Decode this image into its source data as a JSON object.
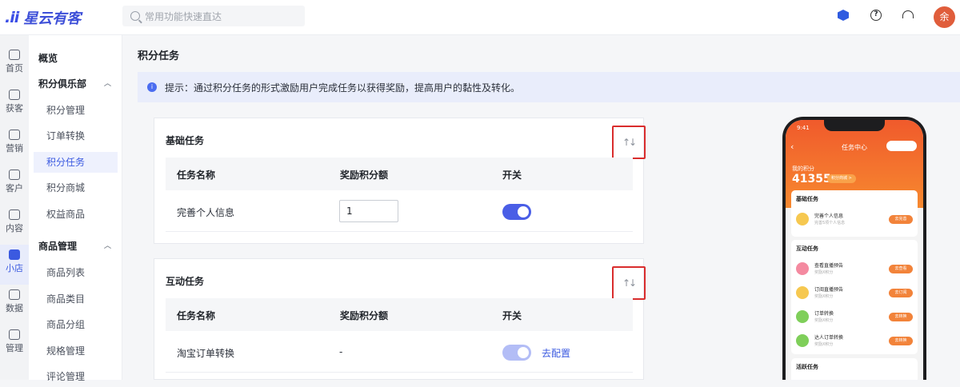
{
  "header": {
    "logo_mark": ".ii",
    "brand": "星云有客",
    "search_placeholder": "常用功能快速直达",
    "help_glyph": "?",
    "avatar_text": "余"
  },
  "rail": {
    "items": [
      {
        "label": "首页",
        "icon": "home-icon"
      },
      {
        "label": "获客",
        "icon": "user-plus-icon"
      },
      {
        "label": "营销",
        "icon": "bulb-icon"
      },
      {
        "label": "客户",
        "icon": "person-icon"
      },
      {
        "label": "内容",
        "icon": "folder-icon"
      },
      {
        "label": "小店",
        "icon": "bag-icon"
      },
      {
        "label": "数据",
        "icon": "pie-icon"
      },
      {
        "label": "管理",
        "icon": "grid-icon"
      }
    ],
    "active": "小店"
  },
  "menu": {
    "overview": "概览",
    "group1": "积分俱乐部",
    "group1_items": [
      "积分管理",
      "订单转换",
      "积分任务",
      "积分商城",
      "权益商品"
    ],
    "group2": "商品管理",
    "group2_items": [
      "商品列表",
      "商品类目",
      "商品分组",
      "规格管理",
      "评论管理"
    ],
    "active": "积分任务"
  },
  "main": {
    "title": "积分任务",
    "tip": "提示：通过积分任务的形式激励用户完成任务以获得奖励，提高用户的黏性及转化。",
    "sort_glyph": "↑↓",
    "basic": {
      "title": "基础任务",
      "col_name": "任务名称",
      "col_points": "奖励积分额",
      "col_switch": "开关",
      "rows": [
        {
          "name": "完善个人信息",
          "points": "1",
          "enabled": true
        }
      ]
    },
    "interactive": {
      "title": "互动任务",
      "col_name": "任务名称",
      "col_points": "奖励积分额",
      "col_switch": "开关",
      "rows": [
        {
          "name": "淘宝订单转换",
          "points": "-",
          "enabled": true,
          "action": "去配置"
        }
      ]
    }
  },
  "phone": {
    "time": "9:41",
    "title": "任务中心",
    "my_points_label": "我的积分",
    "points": "41355",
    "mall_badge": "积分商城 >",
    "basic_title": "基础任务",
    "basic_rows": [
      {
        "name": "完善个人信息",
        "sub": "完善5项个人信息",
        "btn": "去完善"
      }
    ],
    "inter_title": "互动任务",
    "inter_rows": [
      {
        "name": "查看直播预告",
        "sub": "奖励X积分",
        "btn": "去查看"
      },
      {
        "name": "订阅直播预告",
        "sub": "奖励X积分",
        "btn": "去订阅"
      },
      {
        "name": "订单转换",
        "sub": "奖励X积分",
        "btn": "去转换"
      },
      {
        "name": "达人订单转换",
        "sub": "奖励X积分",
        "btn": "去转换"
      }
    ],
    "active_title": "活跃任务"
  }
}
